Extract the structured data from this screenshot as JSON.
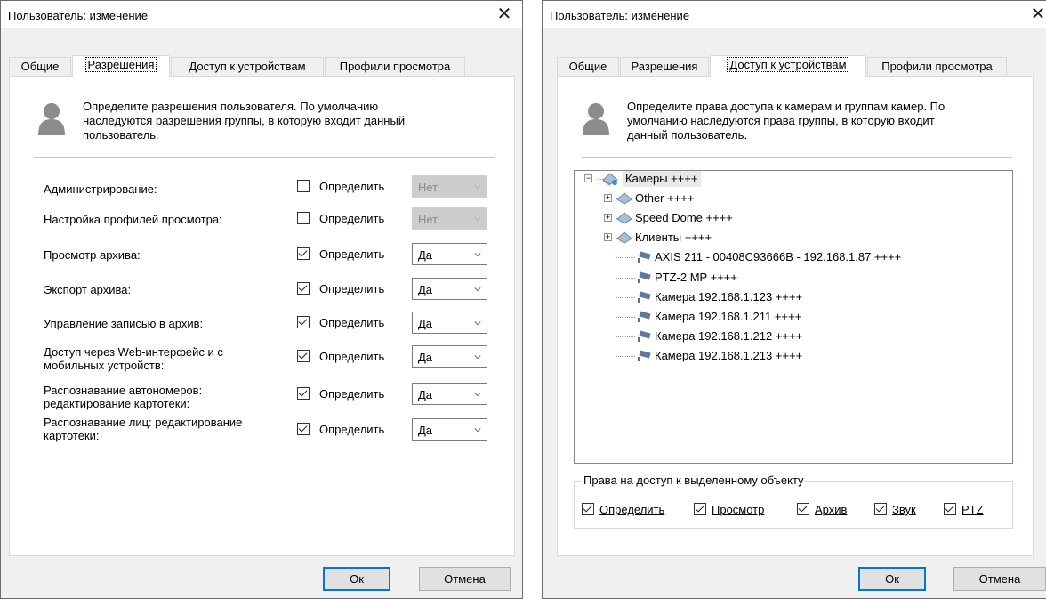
{
  "dialog1": {
    "title": "Пользователь: изменение",
    "tabs": [
      {
        "label": "Общие"
      },
      {
        "label": "Разрешения",
        "active": true
      },
      {
        "label": "Доступ к устройствам"
      },
      {
        "label": "Профили просмотра"
      }
    ],
    "description": [
      "Определите разрешения пользователя. По умолчанию",
      "наследуются разрешения группы, в которую входит данный",
      "пользователь."
    ],
    "define_label": "Определить",
    "permissions": [
      {
        "label": [
          "Администрирование:"
        ],
        "checked": false,
        "value": "Нет",
        "disabled": true
      },
      {
        "label": [
          "Настройка профилей просмотра:"
        ],
        "checked": false,
        "value": "Нет",
        "disabled": true
      },
      {
        "label": [
          "Просмотр архива:"
        ],
        "checked": true,
        "value": "Да",
        "disabled": false
      },
      {
        "label": [
          "Экспорт архива:"
        ],
        "checked": true,
        "value": "Да",
        "disabled": false
      },
      {
        "label": [
          "Управление записью в архив:"
        ],
        "checked": true,
        "value": "Да",
        "disabled": false
      },
      {
        "label": [
          "Доступ через Web-интерфейс и с",
          "мобильных устройств:"
        ],
        "checked": true,
        "value": "Да",
        "disabled": false
      },
      {
        "label": [
          "Распознавание автономеров:",
          "редактирование картотеки:"
        ],
        "checked": true,
        "value": "Да",
        "disabled": false
      },
      {
        "label": [
          "Распознавание лиц: редактирование",
          "картотеки:"
        ],
        "checked": true,
        "value": "Да",
        "disabled": false
      }
    ],
    "ok_label": "Ок",
    "cancel_label": "Отмена"
  },
  "dialog2": {
    "title": "Пользователь: изменение",
    "tabs": [
      {
        "label": "Общие"
      },
      {
        "label": "Разрешения"
      },
      {
        "label": "Доступ к устройствам",
        "active": true
      },
      {
        "label": "Профили просмотра"
      }
    ],
    "description": [
      "Определите права доступа к камерам и группам камер. По",
      "умолчанию наследуются права группы, в которую входит",
      "данный пользователь."
    ],
    "tree": {
      "root": "Камеры ++++",
      "groups": [
        "Other ++++",
        "Speed Dome ++++",
        "Клиенты ++++"
      ],
      "cameras": [
        "AXIS 211 - 00408C93666B - 192.168.1.87 ++++",
        "PTZ-2 MP ++++",
        "Камера 192.168.1.123 ++++",
        "Камера 192.168.1.211 ++++",
        "Камера 192.168.1.212 ++++",
        "Камера 192.168.1.213 ++++"
      ]
    },
    "access_group_title": "Права на доступ к выделенному объекту",
    "access_checks": [
      {
        "label": "Определить",
        "checked": true
      },
      {
        "label": "Просмотр",
        "checked": true
      },
      {
        "label": "Архив",
        "checked": true
      },
      {
        "label": "Звук",
        "checked": true
      },
      {
        "label": "PTZ",
        "checked": true
      }
    ],
    "ok_label": "Ок",
    "cancel_label": "Отмена"
  },
  "close_glyph": "✕",
  "icons": {
    "close": "close-icon",
    "user": "user-icon",
    "camera": "camera-icon",
    "group": "camera-group-icon",
    "chevron": "chevron-down-icon"
  }
}
